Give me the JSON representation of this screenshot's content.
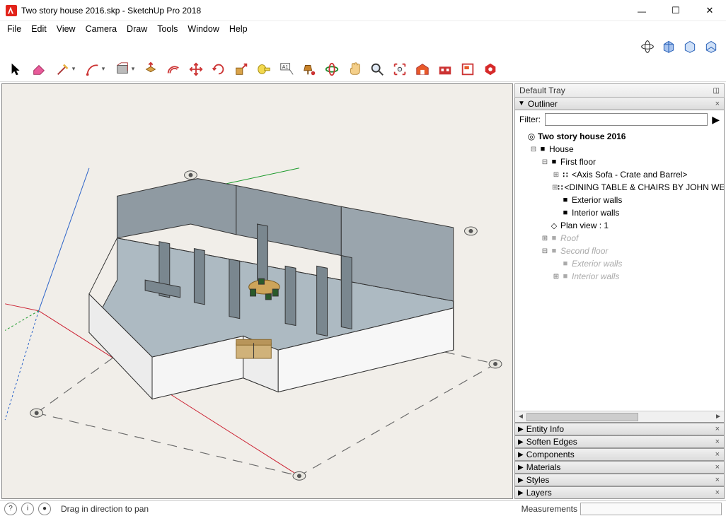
{
  "window": {
    "title": "Two story house 2016.skp - SketchUp Pro 2018"
  },
  "menu": [
    "File",
    "Edit",
    "View",
    "Camera",
    "Draw",
    "Tools",
    "Window",
    "Help"
  ],
  "tray": {
    "title": "Default Tray",
    "outliner": {
      "title": "Outliner",
      "filter_label": "Filter:",
      "filter_value": "",
      "root": "Two story house 2016",
      "house": "House",
      "first_floor": "First floor",
      "axis_sofa": "<Axis Sofa - Crate and Barrel>",
      "dining": "<DINING TABLE & CHAIRS BY JOHN WEICK",
      "ext_walls": "Exterior walls",
      "int_walls": "Interior walls",
      "plan_view": "Plan view : 1",
      "roof": "Roof",
      "second_floor": "Second floor",
      "sf_ext_walls": "Exterior walls",
      "sf_int_walls": "Interior walls"
    },
    "panels": [
      "Entity Info",
      "Soften Edges",
      "Components",
      "Materials",
      "Styles",
      "Layers"
    ]
  },
  "status": {
    "hint": "Drag in direction to pan",
    "measurements_label": "Measurements"
  }
}
